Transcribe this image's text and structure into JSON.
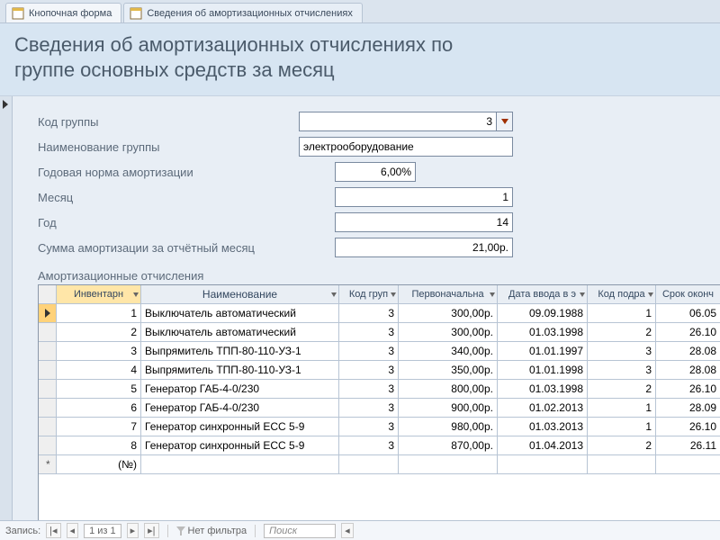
{
  "tabs": [
    {
      "label": "Кнопочная форма"
    },
    {
      "label": "Сведения об амортизационных отчислениях"
    }
  ],
  "header": {
    "line1": "Сведения об амортизационных отчислениях по",
    "line2": "группе основных средств за месяц"
  },
  "form": {
    "group_code": {
      "label": "Код группы",
      "value": "3"
    },
    "group_name": {
      "label": "Наименование группы",
      "value": "электрооборудование"
    },
    "annual_rate": {
      "label": "Годовая норма амортизации",
      "value": "6,00%"
    },
    "month": {
      "label": "Месяц",
      "value": "1"
    },
    "year": {
      "label": "Год",
      "value": "14"
    },
    "total": {
      "label": "Сумма амортизации за отчётный месяц",
      "value": "21,00р."
    }
  },
  "subform_title": "Амортизационные отчисления",
  "columns": {
    "inv": "Инвентарн",
    "name": "Наименование",
    "grp": "Код груп",
    "cost": "Первоначальна",
    "date": "Дата ввода в э",
    "sub": "Код подра",
    "end": "Срок оконч"
  },
  "new_row_placeholder": "(№)",
  "rows": [
    {
      "inv": "1",
      "name": "Выключатель автоматический",
      "grp": "3",
      "cost": "300,00р.",
      "date": "09.09.1988",
      "sub": "1",
      "end": "06.05"
    },
    {
      "inv": "2",
      "name": "Выключатель автоматический",
      "grp": "3",
      "cost": "300,00р.",
      "date": "01.03.1998",
      "sub": "2",
      "end": "26.10"
    },
    {
      "inv": "3",
      "name": "Выпрямитель ТПП-80-110-УЗ-1",
      "grp": "3",
      "cost": "340,00р.",
      "date": "01.01.1997",
      "sub": "3",
      "end": "28.08"
    },
    {
      "inv": "4",
      "name": "Выпрямитель ТПП-80-110-УЗ-1",
      "grp": "3",
      "cost": "350,00р.",
      "date": "01.01.1998",
      "sub": "3",
      "end": "28.08"
    },
    {
      "inv": "5",
      "name": "Генератор ГАБ-4-0/230",
      "grp": "3",
      "cost": "800,00р.",
      "date": "01.03.1998",
      "sub": "2",
      "end": "26.10"
    },
    {
      "inv": "6",
      "name": "Генератор ГАБ-4-0/230",
      "grp": "3",
      "cost": "900,00р.",
      "date": "01.02.2013",
      "sub": "1",
      "end": "28.09"
    },
    {
      "inv": "7",
      "name": "Генератор синхронный ЕСС 5-9",
      "grp": "3",
      "cost": "980,00р.",
      "date": "01.03.2013",
      "sub": "1",
      "end": "26.10"
    },
    {
      "inv": "8",
      "name": "Генератор синхронный ЕСС 5-9",
      "grp": "3",
      "cost": "870,00р.",
      "date": "01.04.2013",
      "sub": "2",
      "end": "26.11"
    }
  ],
  "status": {
    "record_label": "Запись:",
    "nav_first": "|◂",
    "nav_prev": "◂",
    "pos": "1 из 1",
    "nav_next": "▸",
    "nav_last": "▸|",
    "filter_label": "Нет фильтра",
    "search_placeholder": "Поиск"
  }
}
